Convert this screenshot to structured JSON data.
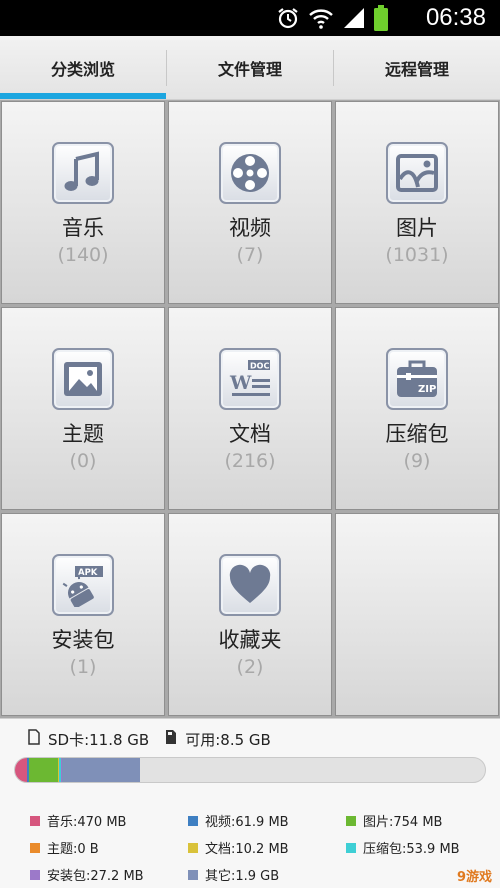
{
  "status_bar": {
    "time": "06:38",
    "icons": [
      "alarm-icon",
      "wifi-icon",
      "signal-icon",
      "battery-icon"
    ]
  },
  "tabs": [
    {
      "label": "分类浏览",
      "selected": true
    },
    {
      "label": "文件管理",
      "selected": false
    },
    {
      "label": "远程管理",
      "selected": false
    }
  ],
  "categories": [
    {
      "name": "音乐",
      "count": "(140)",
      "icon": "music-icon"
    },
    {
      "name": "视频",
      "count": "(7)",
      "icon": "video-reel-icon"
    },
    {
      "name": "图片",
      "count": "(1031)",
      "icon": "picture-icon"
    },
    {
      "name": "主题",
      "count": "(0)",
      "icon": "theme-icon"
    },
    {
      "name": "文档",
      "count": "(216)",
      "icon": "document-icon"
    },
    {
      "name": "压缩包",
      "count": "(9)",
      "icon": "zip-icon"
    },
    {
      "name": "安装包",
      "count": "(1)",
      "icon": "apk-icon"
    },
    {
      "name": "收藏夹",
      "count": "(2)",
      "icon": "heart-icon"
    }
  ],
  "storage": {
    "sd_card": "SD卡:11.8 GB",
    "available": "可用:8.5 GB",
    "legend": [
      {
        "label": "音乐:470 MB",
        "color": "#d6567e"
      },
      {
        "label": "视频:61.9 MB",
        "color": "#3e7fc2"
      },
      {
        "label": "图片:754 MB",
        "color": "#6cb832"
      },
      {
        "label": "主题:0 B",
        "color": "#ea8b2b"
      },
      {
        "label": "文档:10.2 MB",
        "color": "#d9c23a"
      },
      {
        "label": "压缩包:53.9 MB",
        "color": "#3ecfd5"
      },
      {
        "label": "安装包:27.2 MB",
        "color": "#9c79c9"
      },
      {
        "label": "其它:1.9 GB",
        "color": "#7f90b8"
      }
    ]
  },
  "watermark": "9游戏"
}
